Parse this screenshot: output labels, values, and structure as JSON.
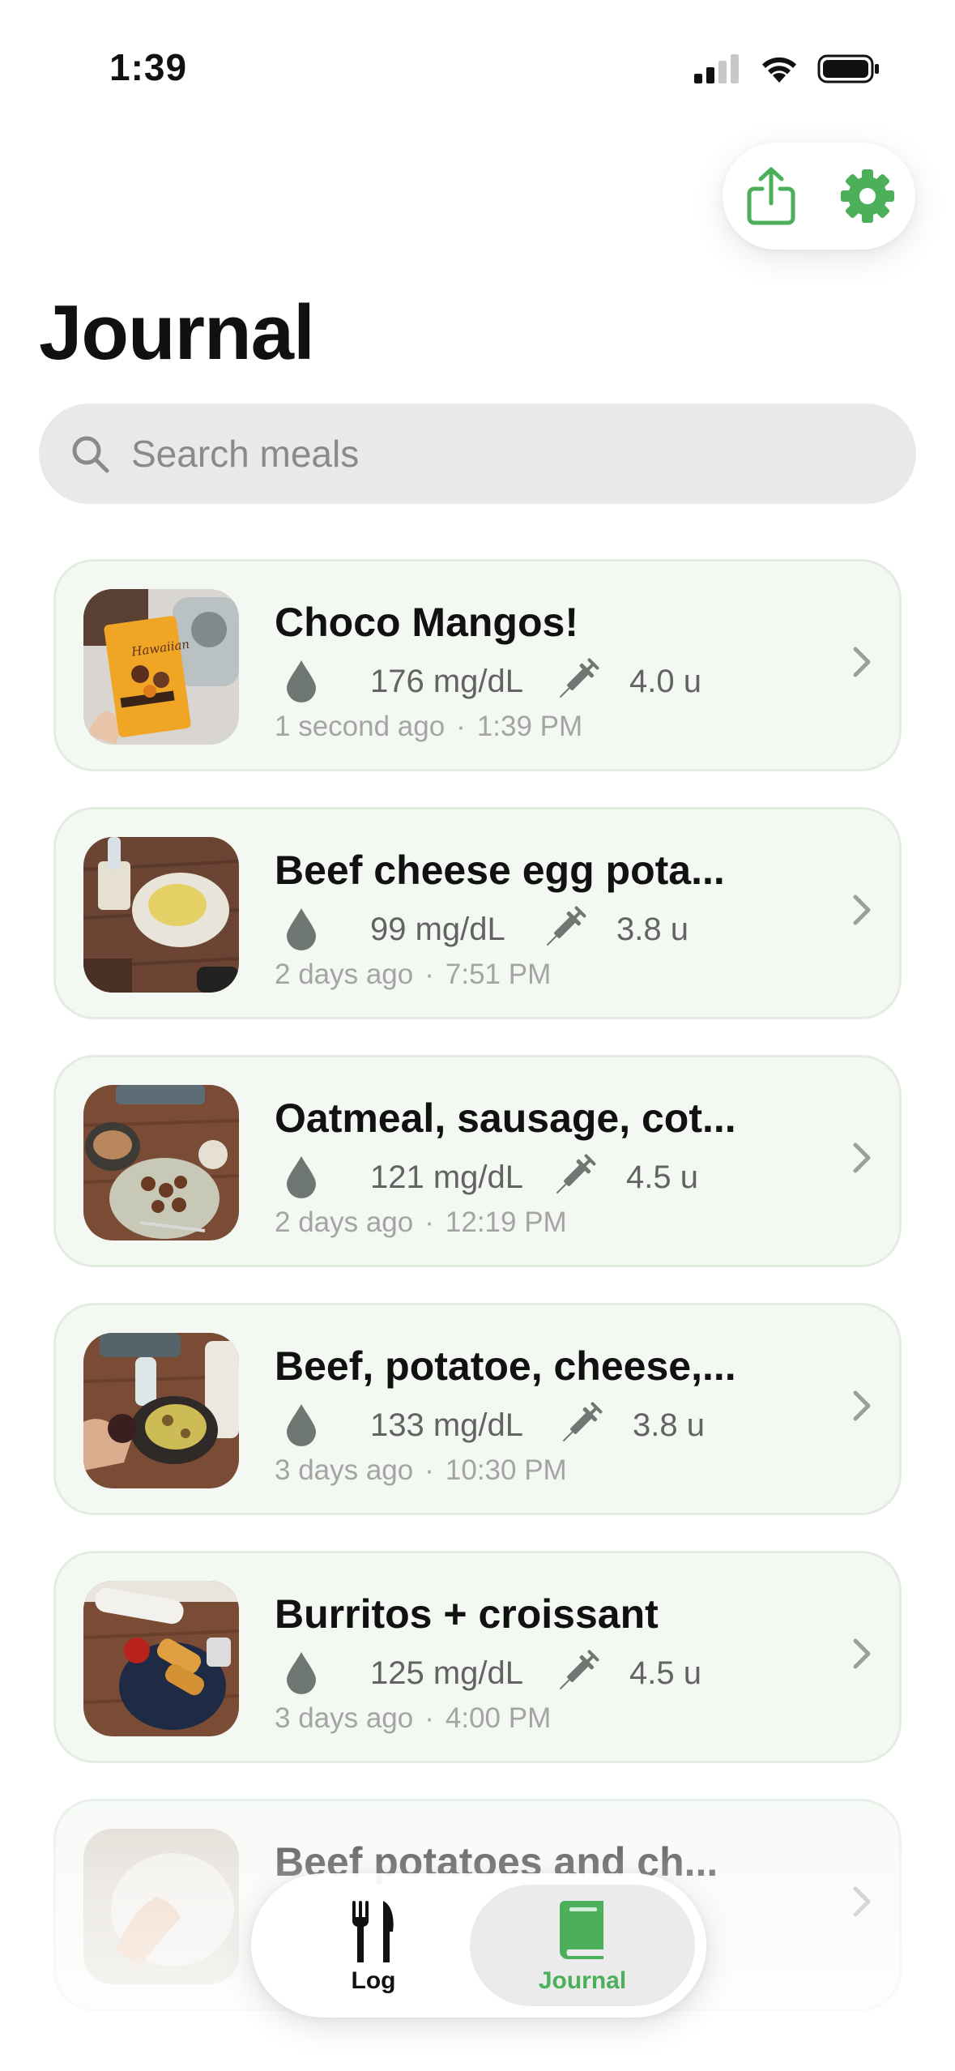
{
  "status_bar": {
    "time": "1:39"
  },
  "top_actions": {
    "share_icon": "share-icon",
    "settings_icon": "gear-icon",
    "accent_color": "#4caf5a"
  },
  "page": {
    "title": "Journal"
  },
  "search": {
    "placeholder": "Search meals",
    "value": ""
  },
  "meals": [
    {
      "name": "Choco Mangos!",
      "glucose": "176 mg/dL",
      "insulin": "4.0 u",
      "relative_time": "1 second ago",
      "time": "1:39 PM"
    },
    {
      "name": "Beef cheese egg pota...",
      "glucose": "99 mg/dL",
      "insulin": "3.8 u",
      "relative_time": "2 days ago",
      "time": "7:51 PM"
    },
    {
      "name": "Oatmeal, sausage, cot...",
      "glucose": "121 mg/dL",
      "insulin": "4.5 u",
      "relative_time": "2 days ago",
      "time": "12:19 PM"
    },
    {
      "name": "Beef, potatoe, cheese,...",
      "glucose": "133 mg/dL",
      "insulin": "3.8 u",
      "relative_time": "3 days ago",
      "time": "10:30 PM"
    },
    {
      "name": "Burritos + croissant",
      "glucose": "125 mg/dL",
      "insulin": "4.5 u",
      "relative_time": "3 days ago",
      "time": "4:00 PM"
    },
    {
      "name": "Beef potatoes and ch...",
      "glucose": "",
      "insulin": "",
      "relative_time": "",
      "time": ""
    }
  ],
  "meta_separator": "·",
  "tab_bar": {
    "tabs": [
      {
        "label": "Log",
        "icon": "fork-knife-icon",
        "selected": false
      },
      {
        "label": "Journal",
        "icon": "book-icon",
        "selected": true
      }
    ]
  }
}
